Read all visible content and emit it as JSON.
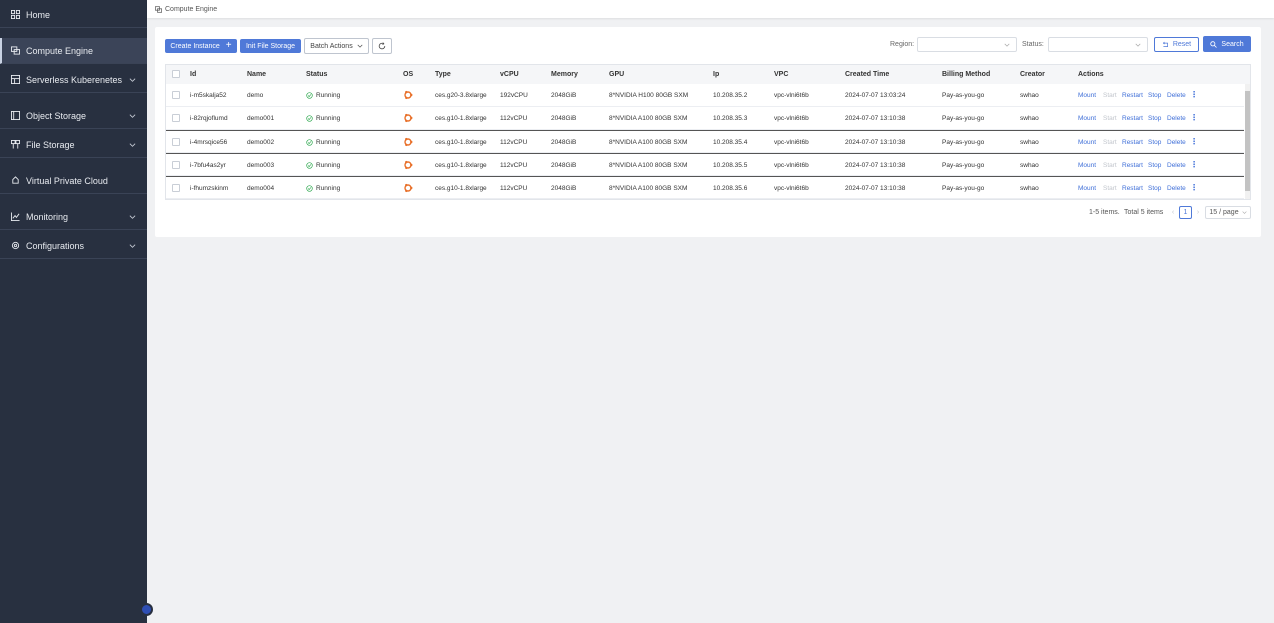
{
  "sidebar": {
    "items": [
      {
        "label": "Home",
        "icon": "grid-icon"
      },
      {
        "label": "Compute Engine",
        "icon": "server-icon"
      },
      {
        "label": "Serverless Kuberenetes",
        "icon": "container-icon"
      },
      {
        "label": "Object Storage",
        "icon": "storage-icon"
      },
      {
        "label": "File Storage",
        "icon": "file-storage-icon"
      },
      {
        "label": "Virtual Private Cloud",
        "icon": "cloud-icon"
      },
      {
        "label": "Monitoring",
        "icon": "chart-icon"
      },
      {
        "label": "Configurations",
        "icon": "gear-icon"
      }
    ]
  },
  "breadcrumb": {
    "label": "Compute Engine"
  },
  "toolbar": {
    "create_label": "Create Instance",
    "init_label": "Init File Storage",
    "batch_label": "Batch Actions",
    "region_label": "Region:",
    "status_label": "Status:",
    "reset_label": "Reset",
    "search_label": "Search"
  },
  "table": {
    "columns": [
      "Id",
      "Name",
      "Status",
      "OS",
      "Type",
      "vCPU",
      "Memory",
      "GPU",
      "Ip",
      "VPC",
      "Created Time",
      "Billing Method",
      "Creator",
      "Actions"
    ],
    "actions": [
      "Mount",
      "Start",
      "Restart",
      "Stop",
      "Delete"
    ],
    "rows": [
      {
        "id": "i-m5skalja52",
        "name": "demo",
        "status": "Running",
        "type": "ces.g20-3.8xlarge",
        "vcpu": "192vCPU",
        "memory": "2048GiB",
        "gpu": "8*NVIDIA H100 80GB SXM",
        "ip": "10.208.35.2",
        "vpc": "vpc-vlni6t6b",
        "created": "2024-07-07 13:03:24",
        "billing": "Pay-as-you-go",
        "creator": "swhao"
      },
      {
        "id": "i-82rqjoflumd",
        "name": "demo001",
        "status": "Running",
        "type": "ces.g10-1.8xlarge",
        "vcpu": "112vCPU",
        "memory": "2048GiB",
        "gpu": "8*NVIDIA A100 80GB SXM",
        "ip": "10.208.35.3",
        "vpc": "vpc-vlni6t6b",
        "created": "2024-07-07 13:10:38",
        "billing": "Pay-as-you-go",
        "creator": "swhao"
      },
      {
        "id": "i-4mrsqice56",
        "name": "demo002",
        "status": "Running",
        "type": "ces.g10-1.8xlarge",
        "vcpu": "112vCPU",
        "memory": "2048GiB",
        "gpu": "8*NVIDIA A100 80GB SXM",
        "ip": "10.208.35.4",
        "vpc": "vpc-vlni6t6b",
        "created": "2024-07-07 13:10:38",
        "billing": "Pay-as-you-go",
        "creator": "swhao"
      },
      {
        "id": "i-7bfu4as2yr",
        "name": "demo003",
        "status": "Running",
        "type": "ces.g10-1.8xlarge",
        "vcpu": "112vCPU",
        "memory": "2048GiB",
        "gpu": "8*NVIDIA A100 80GB SXM",
        "ip": "10.208.35.5",
        "vpc": "vpc-vlni6t6b",
        "created": "2024-07-07 13:10:38",
        "billing": "Pay-as-you-go",
        "creator": "swhao"
      },
      {
        "id": "i-fhumzskinm",
        "name": "demo004",
        "status": "Running",
        "type": "ces.g10-1.8xlarge",
        "vcpu": "112vCPU",
        "memory": "2048GiB",
        "gpu": "8*NVIDIA A100 80GB SXM",
        "ip": "10.208.35.6",
        "vpc": "vpc-vlni6t6b",
        "created": "2024-07-07 13:10:38",
        "billing": "Pay-as-you-go",
        "creator": "swhao"
      }
    ]
  },
  "pagination": {
    "range": "1-5 items.",
    "total": "Total 5 items",
    "page": "1",
    "per_page": "15 / page"
  },
  "colors": {
    "sidebar": "#283040",
    "accent": "#4f79d8",
    "running": "#2fa84f",
    "os": "#e8702a"
  }
}
